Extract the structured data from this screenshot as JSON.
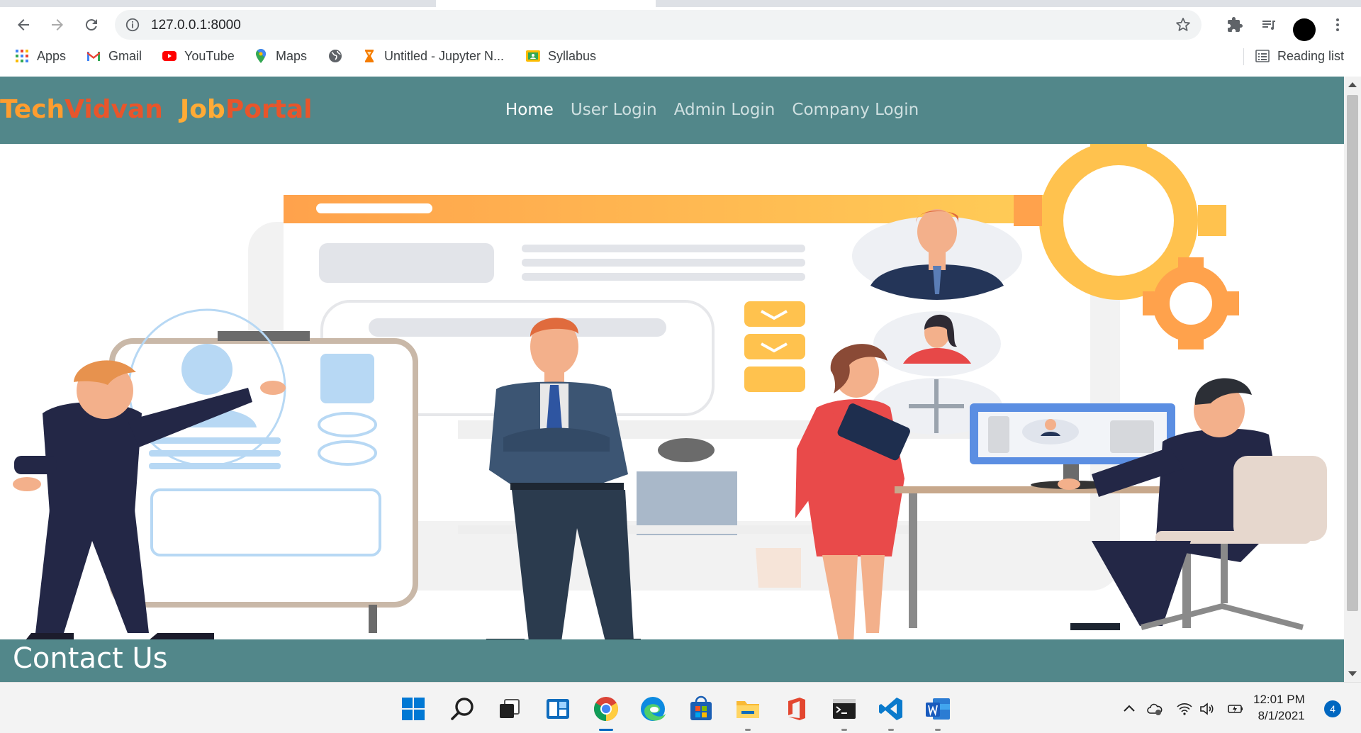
{
  "browser": {
    "url": "127.0.0.1:8000",
    "bookmarks": [
      {
        "label": "Apps",
        "icon": "apps-grid-icon"
      },
      {
        "label": "Gmail",
        "icon": "gmail-icon"
      },
      {
        "label": "YouTube",
        "icon": "youtube-icon"
      },
      {
        "label": "Maps",
        "icon": "maps-pin-icon"
      },
      {
        "label": "",
        "icon": "globe-icon"
      },
      {
        "label": "Untitled - Jupyter N...",
        "icon": "hourglass-icon"
      },
      {
        "label": "Syllabus",
        "icon": "classroom-icon"
      }
    ],
    "reading_list": "Reading list"
  },
  "site": {
    "logo": {
      "part1": "Tech",
      "part2": "Vidvan",
      "part3": "Job",
      "part4": "Portal"
    },
    "nav": [
      "Home",
      "User Login",
      "Admin Login",
      "Company Login"
    ],
    "active_nav": "Home",
    "colors": {
      "nav_bg": "#52878a",
      "logo_orange": "#ff9d2f",
      "logo_red": "#e8552b"
    },
    "contact_title": "Contact Us"
  },
  "taskbar": {
    "apps": [
      "windows-start-icon",
      "search-icon",
      "task-view-icon",
      "widgets-icon",
      "chrome-icon",
      "edge-icon",
      "store-icon",
      "file-explorer-icon",
      "office-icon",
      "terminal-icon",
      "vscode-icon",
      "word-icon"
    ],
    "time": "12:01 PM",
    "date": "8/1/2021",
    "notifications": "4"
  }
}
